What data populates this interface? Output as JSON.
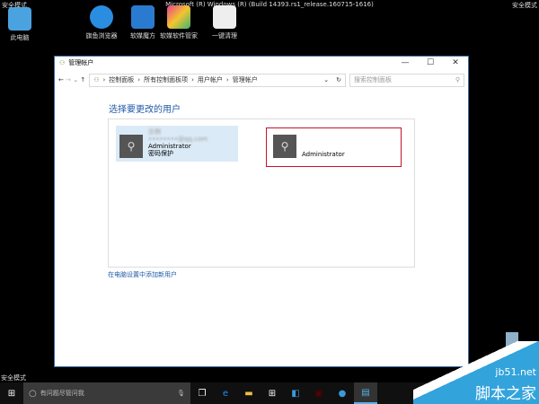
{
  "desktop": {
    "safe_mode": "安全模式",
    "build": "Microsoft (R) Windows (R) (Build 14393.rs1_release.160715-1616)",
    "icons": [
      {
        "label": "此电脑",
        "color": "#4aa3df"
      },
      {
        "label": "旗鱼浏览器",
        "color": "#2b8de0"
      },
      {
        "label": "软媒魔方",
        "color": "#2a7bd0"
      },
      {
        "label": "软媒软件管家",
        "color": "#e8408a"
      },
      {
        "label": "一键清理",
        "color": "#eeeeee"
      }
    ]
  },
  "window": {
    "title": "管理帐户",
    "minimize": "—",
    "maximize": "☐",
    "close": "✕",
    "breadcrumb": [
      "控制面板",
      "所有控制面板项",
      "用户帐户",
      "管理帐户"
    ],
    "search_placeholder": "搜索控制面板",
    "heading": "选择要更改的用户",
    "accounts": [
      {
        "name": "示例",
        "email": "••••••••@qq.com",
        "type": "Administrator",
        "status": "密码保护"
      },
      {
        "type": "Administrator"
      }
    ],
    "add_user_link": "在电脑设置中添加新用户"
  },
  "taskbar": {
    "search_placeholder": "有问题尽管问我"
  },
  "watermark": {
    "site": "jb51.net",
    "name": "脚本之家"
  }
}
